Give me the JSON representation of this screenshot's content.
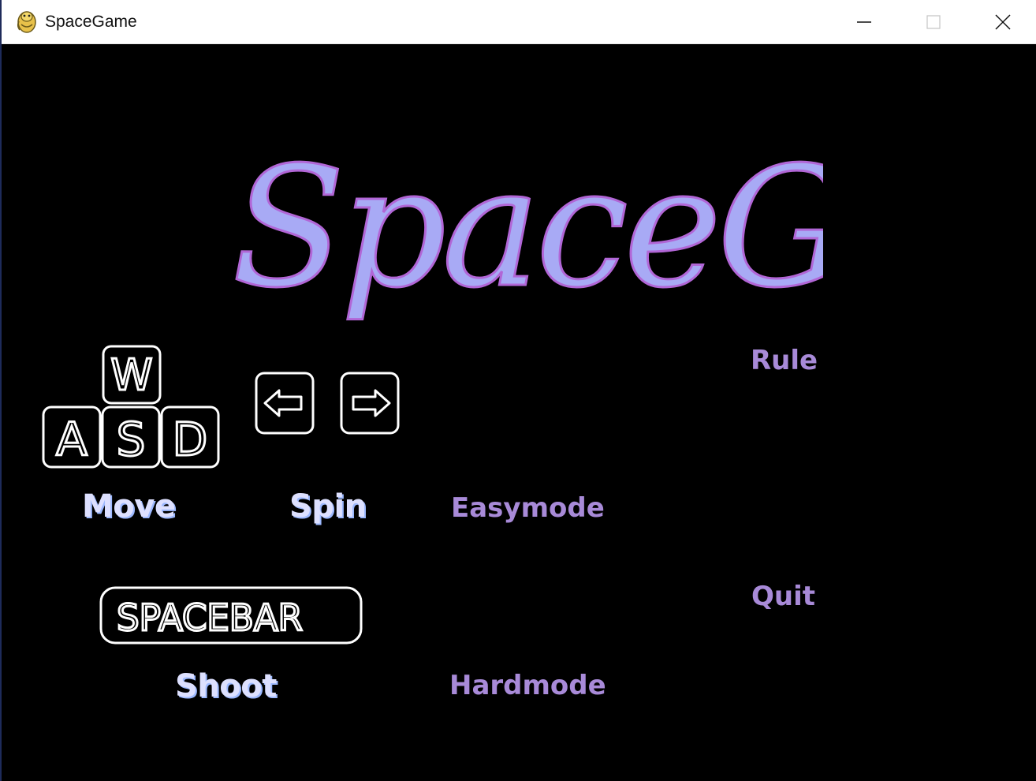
{
  "window": {
    "title": "SpaceGame",
    "icon": "pygame-snake-icon",
    "buttons": [
      "minimize",
      "maximize",
      "close"
    ]
  },
  "logo": {
    "text": "SpaceGame",
    "fill_color": "#a8aaf5",
    "outline_color": "#b166d6"
  },
  "controls": {
    "move_keys": [
      "W",
      "A",
      "S",
      "D"
    ],
    "move_label": "Move",
    "spin_keys": [
      "left-arrow-icon",
      "right-arrow-icon"
    ],
    "spin_label": "Spin",
    "shoot_key": "SPACEBAR",
    "shoot_label": "Shoot"
  },
  "menu": {
    "easymode": "Easymode",
    "hardmode": "Hardmode",
    "rule": "Rule",
    "quit": "Quit"
  },
  "colors": {
    "background": "#000000",
    "menu_text": "#a88ad8",
    "control_label": "#dde0ff",
    "keycap_outline": "#ffffff"
  }
}
